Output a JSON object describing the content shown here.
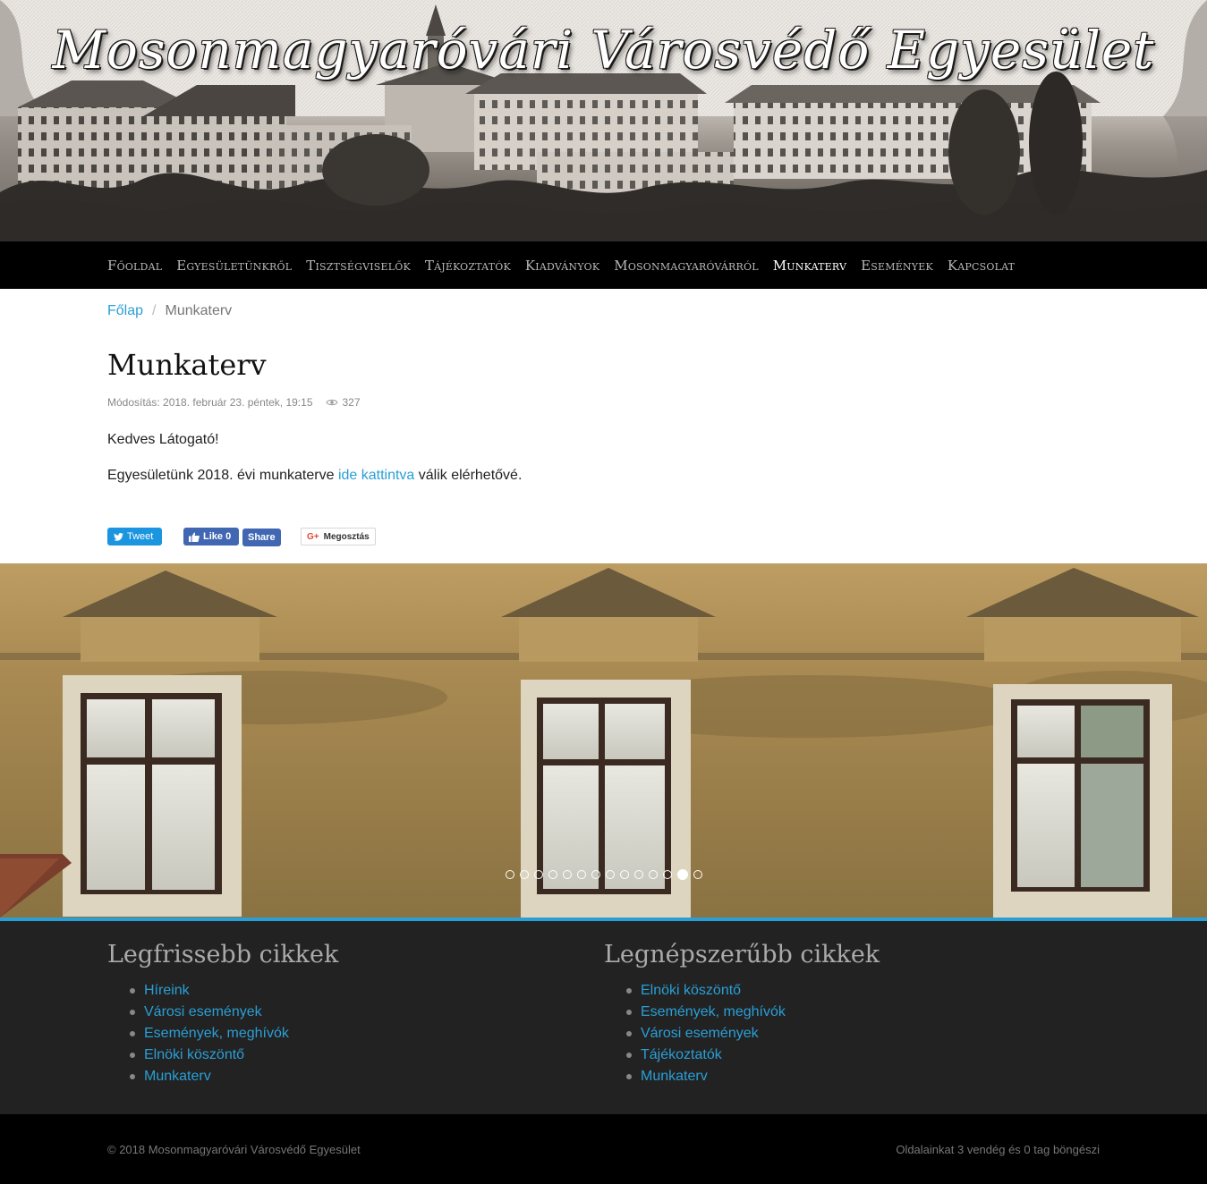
{
  "header": {
    "site_title": "Mosonmagyaróvári Városvédő Egyesület"
  },
  "nav": {
    "items": [
      {
        "label": "Főoldal"
      },
      {
        "label": "Egyesületünkről"
      },
      {
        "label": "Tisztségviselők"
      },
      {
        "label": "Tájékoztatók"
      },
      {
        "label": "Kiadványok"
      },
      {
        "label": "Mosonmagyaróvárról"
      },
      {
        "label": "Munkaterv"
      },
      {
        "label": "Események"
      },
      {
        "label": "Kapcsolat"
      }
    ],
    "active": "Munkaterv"
  },
  "breadcrumb": {
    "home": "Főlap",
    "separator": "/",
    "current": "Munkaterv"
  },
  "article": {
    "title": "Munkaterv",
    "modified": "Módosítás: 2018. február 23. péntek, 19:15",
    "views": "327",
    "greeting": "Kedves Látogató!",
    "text_before": "Egyesületünk 2018. évi munkaterve ",
    "link_text": "ide kattintva",
    "text_after": " válik elérhetővé."
  },
  "share": {
    "tweet": "Tweet",
    "fb_like": "Like",
    "fb_count": "0",
    "fb_share": "Share",
    "gplus": "Megosztás"
  },
  "carousel": {
    "slide_count": 14,
    "active_index": 12
  },
  "widgets": {
    "latest": {
      "title": "Legfrissebb cikkek",
      "items": [
        "Híreink",
        "Városi események",
        "Események, meghívók",
        "Elnöki köszöntő",
        "Munkaterv"
      ]
    },
    "popular": {
      "title": "Legnépszerűbb cikkek",
      "items": [
        "Elnöki köszöntő",
        "Események, meghívók",
        "Városi események",
        "Tájékoztatók",
        "Munkaterv"
      ]
    }
  },
  "footer": {
    "copyright": "© 2018 Mosonmagyaróvári Városvédő Egyesület",
    "visitors": "Oldalainkat 3 vendég és 0 tag böngészi"
  },
  "colors": {
    "accent": "#2a9fd6",
    "nav_bg": "#000000",
    "widgets_bg": "#222222"
  }
}
